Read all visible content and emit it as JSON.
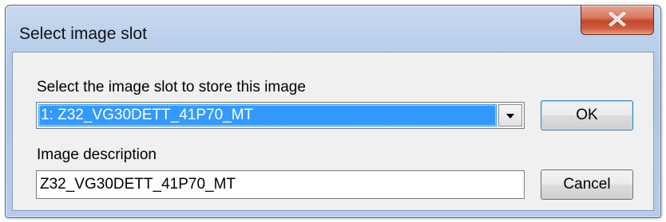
{
  "window": {
    "title": "Select image slot"
  },
  "form": {
    "slot_label": "Select the image slot to store this image",
    "slot_selected": "1: Z32_VG30DETT_41P70_MT",
    "description_label": "Image description",
    "description_value": "Z32_VG30DETT_41P70_MT"
  },
  "buttons": {
    "ok_label": "OK",
    "cancel_label": "Cancel"
  },
  "icons": {
    "close": "close-x-icon",
    "dropdown": "chevron-down-icon"
  },
  "colors": {
    "selection": "#3399ff",
    "close_button": "#c2482b"
  }
}
